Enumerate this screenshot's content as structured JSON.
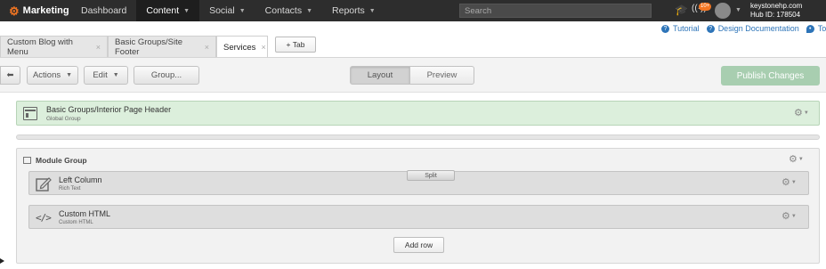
{
  "topnav": {
    "brand": "Marketing",
    "items": [
      {
        "label": "Dashboard",
        "caret": false
      },
      {
        "label": "Content",
        "caret": true,
        "active": true
      },
      {
        "label": "Social",
        "caret": true
      },
      {
        "label": "Contacts",
        "caret": true
      },
      {
        "label": "Reports",
        "caret": true
      }
    ],
    "search_placeholder": "Search",
    "notification_count": "10+",
    "account_domain": "keystonehp.com",
    "hub_id": "Hub ID: 178504"
  },
  "tabs": {
    "items": [
      {
        "label": "Custom Blog with Menu",
        "active": false
      },
      {
        "label": "Basic Groups/Site Footer",
        "active": false
      },
      {
        "label": "Services",
        "active": true
      }
    ],
    "add_tab_label": "+ Tab",
    "help_links": [
      "Tutorial",
      "Design Documentation",
      "Tou"
    ]
  },
  "toolbar": {
    "back_glyph": "⬅",
    "actions_label": "Actions",
    "edit_label": "Edit",
    "group_label": "Group...",
    "layout_label": "Layout",
    "preview_label": "Preview",
    "publish_label": "Publish Changes"
  },
  "canvas": {
    "global_group": {
      "title": "Basic Groups/Interior Page Header",
      "subtitle": "Global Group"
    },
    "module_group": {
      "title": "Module Group",
      "split_label": "Split",
      "modules": [
        {
          "title": "Left Column",
          "subtitle": "Rich Text",
          "icon": "pencil-icon"
        },
        {
          "title": "Custom HTML",
          "subtitle": "Custom HTML",
          "icon": "code-icon"
        }
      ],
      "add_row_label": "Add row"
    }
  },
  "colors": {
    "nav_bg": "#2d2d2d",
    "brand_orange": "#f47622",
    "link_blue": "#2d74b8",
    "publish_green": "#a8ceb0",
    "global_group_green": "#dcefdc"
  }
}
